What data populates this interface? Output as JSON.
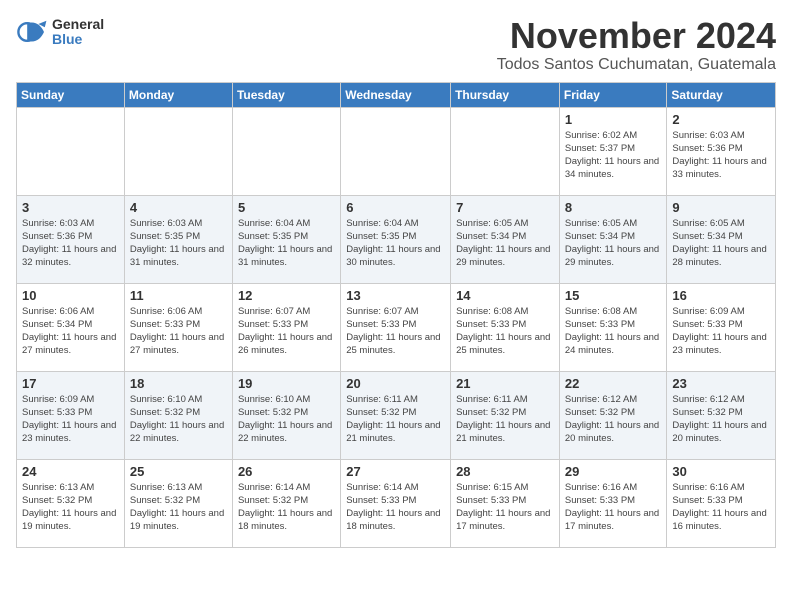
{
  "logo": {
    "general": "General",
    "blue": "Blue"
  },
  "title": "November 2024",
  "subtitle": "Todos Santos Cuchumatan, Guatemala",
  "headers": [
    "Sunday",
    "Monday",
    "Tuesday",
    "Wednesday",
    "Thursday",
    "Friday",
    "Saturday"
  ],
  "weeks": [
    [
      {
        "num": "",
        "info": ""
      },
      {
        "num": "",
        "info": ""
      },
      {
        "num": "",
        "info": ""
      },
      {
        "num": "",
        "info": ""
      },
      {
        "num": "",
        "info": ""
      },
      {
        "num": "1",
        "info": "Sunrise: 6:02 AM\nSunset: 5:37 PM\nDaylight: 11 hours and 34 minutes."
      },
      {
        "num": "2",
        "info": "Sunrise: 6:03 AM\nSunset: 5:36 PM\nDaylight: 11 hours and 33 minutes."
      }
    ],
    [
      {
        "num": "3",
        "info": "Sunrise: 6:03 AM\nSunset: 5:36 PM\nDaylight: 11 hours and 32 minutes."
      },
      {
        "num": "4",
        "info": "Sunrise: 6:03 AM\nSunset: 5:35 PM\nDaylight: 11 hours and 31 minutes."
      },
      {
        "num": "5",
        "info": "Sunrise: 6:04 AM\nSunset: 5:35 PM\nDaylight: 11 hours and 31 minutes."
      },
      {
        "num": "6",
        "info": "Sunrise: 6:04 AM\nSunset: 5:35 PM\nDaylight: 11 hours and 30 minutes."
      },
      {
        "num": "7",
        "info": "Sunrise: 6:05 AM\nSunset: 5:34 PM\nDaylight: 11 hours and 29 minutes."
      },
      {
        "num": "8",
        "info": "Sunrise: 6:05 AM\nSunset: 5:34 PM\nDaylight: 11 hours and 29 minutes."
      },
      {
        "num": "9",
        "info": "Sunrise: 6:05 AM\nSunset: 5:34 PM\nDaylight: 11 hours and 28 minutes."
      }
    ],
    [
      {
        "num": "10",
        "info": "Sunrise: 6:06 AM\nSunset: 5:34 PM\nDaylight: 11 hours and 27 minutes."
      },
      {
        "num": "11",
        "info": "Sunrise: 6:06 AM\nSunset: 5:33 PM\nDaylight: 11 hours and 27 minutes."
      },
      {
        "num": "12",
        "info": "Sunrise: 6:07 AM\nSunset: 5:33 PM\nDaylight: 11 hours and 26 minutes."
      },
      {
        "num": "13",
        "info": "Sunrise: 6:07 AM\nSunset: 5:33 PM\nDaylight: 11 hours and 25 minutes."
      },
      {
        "num": "14",
        "info": "Sunrise: 6:08 AM\nSunset: 5:33 PM\nDaylight: 11 hours and 25 minutes."
      },
      {
        "num": "15",
        "info": "Sunrise: 6:08 AM\nSunset: 5:33 PM\nDaylight: 11 hours and 24 minutes."
      },
      {
        "num": "16",
        "info": "Sunrise: 6:09 AM\nSunset: 5:33 PM\nDaylight: 11 hours and 23 minutes."
      }
    ],
    [
      {
        "num": "17",
        "info": "Sunrise: 6:09 AM\nSunset: 5:33 PM\nDaylight: 11 hours and 23 minutes."
      },
      {
        "num": "18",
        "info": "Sunrise: 6:10 AM\nSunset: 5:32 PM\nDaylight: 11 hours and 22 minutes."
      },
      {
        "num": "19",
        "info": "Sunrise: 6:10 AM\nSunset: 5:32 PM\nDaylight: 11 hours and 22 minutes."
      },
      {
        "num": "20",
        "info": "Sunrise: 6:11 AM\nSunset: 5:32 PM\nDaylight: 11 hours and 21 minutes."
      },
      {
        "num": "21",
        "info": "Sunrise: 6:11 AM\nSunset: 5:32 PM\nDaylight: 11 hours and 21 minutes."
      },
      {
        "num": "22",
        "info": "Sunrise: 6:12 AM\nSunset: 5:32 PM\nDaylight: 11 hours and 20 minutes."
      },
      {
        "num": "23",
        "info": "Sunrise: 6:12 AM\nSunset: 5:32 PM\nDaylight: 11 hours and 20 minutes."
      }
    ],
    [
      {
        "num": "24",
        "info": "Sunrise: 6:13 AM\nSunset: 5:32 PM\nDaylight: 11 hours and 19 minutes."
      },
      {
        "num": "25",
        "info": "Sunrise: 6:13 AM\nSunset: 5:32 PM\nDaylight: 11 hours and 19 minutes."
      },
      {
        "num": "26",
        "info": "Sunrise: 6:14 AM\nSunset: 5:32 PM\nDaylight: 11 hours and 18 minutes."
      },
      {
        "num": "27",
        "info": "Sunrise: 6:14 AM\nSunset: 5:33 PM\nDaylight: 11 hours and 18 minutes."
      },
      {
        "num": "28",
        "info": "Sunrise: 6:15 AM\nSunset: 5:33 PM\nDaylight: 11 hours and 17 minutes."
      },
      {
        "num": "29",
        "info": "Sunrise: 6:16 AM\nSunset: 5:33 PM\nDaylight: 11 hours and 17 minutes."
      },
      {
        "num": "30",
        "info": "Sunrise: 6:16 AM\nSunset: 5:33 PM\nDaylight: 11 hours and 16 minutes."
      }
    ]
  ]
}
